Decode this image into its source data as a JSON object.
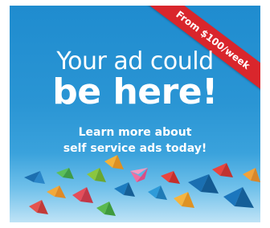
{
  "ad": {
    "headline_line1": "Your ad could",
    "headline_line2": "be here!",
    "sub_line1": "Learn more about",
    "sub_line2": "self service ads today!",
    "ribbon": "From $100/week"
  },
  "colors": {
    "background_top": "#1f8ccf",
    "background_bottom": "#bfe3f6",
    "ribbon": "#d9262c",
    "text": "#ffffff"
  },
  "decoration": "paper-bird-flock-icon"
}
